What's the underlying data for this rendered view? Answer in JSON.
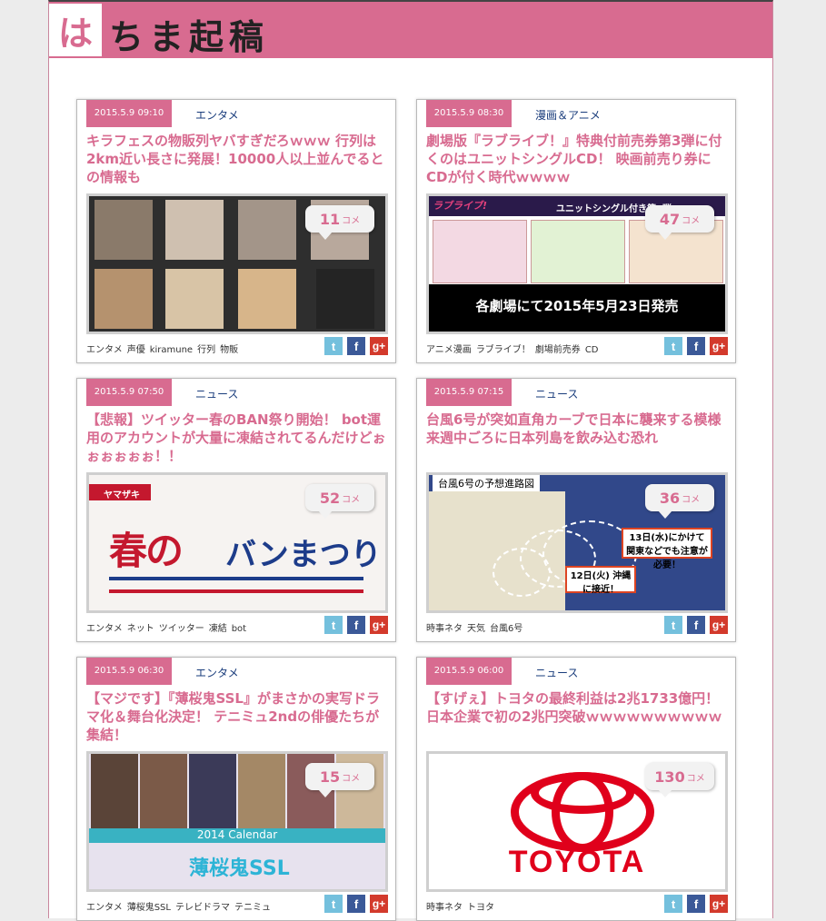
{
  "site": {
    "logo_char": "は",
    "logo_rest": "ちま起稿"
  },
  "articles": [
    {
      "date": "2015.5.9 09:10",
      "category": "エンタメ",
      "title": "キラフェスの物販列ヤバすぎだろｗｗｗ 行列は2km近い長さに発展！10000人以上並んでるとの情報も",
      "comments": "11",
      "comment_unit": "コメ",
      "tags": [
        "エンタメ",
        "声優",
        "kiramune",
        "行列",
        "物販"
      ]
    },
    {
      "date": "2015.5.9 08:30",
      "category": "漫画＆アニメ",
      "title": "劇場版『ラブライブ！』特典付前売券第3弾に付くのはユニットシングルCD！ 映画前売り券にCDが付く時代ｗｗｗｗ",
      "comments": "47",
      "comment_unit": "コメ",
      "tags": [
        "アニメ漫画",
        "ラブライブ！",
        "劇場前売券",
        "CD"
      ],
      "thumb_text": {
        "logo": "ラブライブ!",
        "header": "ユニットシングル付き第3弾",
        "big": "各劇場にて2015年5月23日発売"
      }
    },
    {
      "date": "2015.5.9 07:50",
      "category": "ニュース",
      "title": "【悲報】ツイッター春のBAN祭り開始！ bot運用のアカウントが大量に凍結されてるんだけどぉぉぉぉぉぉ！！",
      "comments": "52",
      "comment_unit": "コメ",
      "tags": [
        "エンタメ",
        "ネット",
        "ツイッター",
        "凍結",
        "bot"
      ],
      "thumb_text": {
        "bar": "ヤマザキ",
        "main": "春の",
        "sub": "バンまつり"
      }
    },
    {
      "date": "2015.5.9 07:15",
      "category": "ニュース",
      "title": "台風6号が突如直角カーブで日本に襲来する模様　来週中ごろに日本列島を飲み込む恐れ",
      "comments": "36",
      "comment_unit": "コメ",
      "tags": [
        "時事ネタ",
        "天気",
        "台風6号"
      ],
      "thumb_text": {
        "title": "台風6号の予想進路図",
        "note1": "13日(水)にかけて 関東などでも注意が必要！",
        "note2": "12日(火) 沖縄に接近！"
      }
    },
    {
      "date": "2015.5.9 06:30",
      "category": "エンタメ",
      "title": "【マジです】『薄桜鬼SSL』がまさかの実写ドラマ化＆舞台化決定！ テニミュ2ndの俳優たちが集結！",
      "comments": "15",
      "comment_unit": "コメ",
      "tags": [
        "エンタメ",
        "薄桜鬼SSL",
        "テレビドラマ",
        "テニミュ"
      ],
      "thumb_text": {
        "calendar": "2014 Calendar",
        "logo": "薄桜鬼SSL"
      }
    },
    {
      "date": "2015.5.9 06:00",
      "category": "ニュース",
      "title": "【すげぇ】トヨタの最終利益は2兆1733億円！日本企業で初の2兆円突破ｗｗｗｗｗｗｗｗｗｗ",
      "comments": "130",
      "comment_unit": "コメ",
      "tags": [
        "時事ネタ",
        "トヨタ"
      ],
      "thumb_text": {
        "word": "TOYOTA"
      }
    }
  ],
  "social": {
    "twitter": "t",
    "facebook": "f",
    "gplus": "g+"
  }
}
